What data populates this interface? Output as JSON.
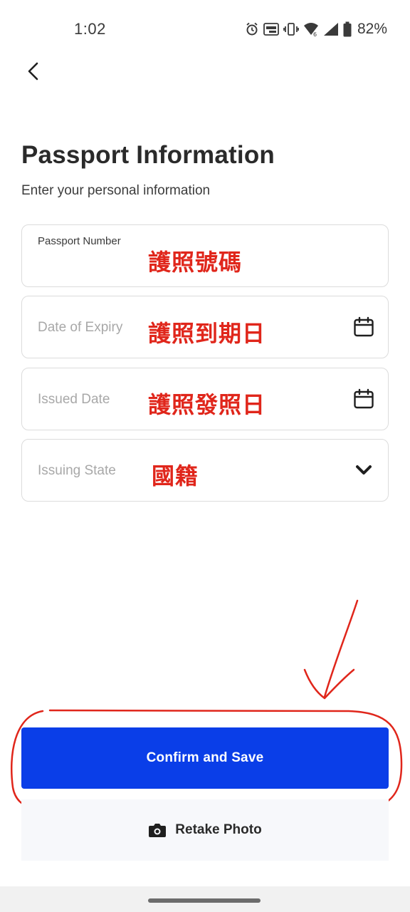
{
  "status_bar": {
    "time": "1:02",
    "battery": "82%",
    "icons": [
      "alarm-icon",
      "auto-brightness-icon",
      "vibrate-icon",
      "wifi-icon",
      "signal-icon",
      "battery-icon"
    ]
  },
  "header": {
    "back_icon": "chevron-left-icon",
    "title": "Passport Information",
    "subtitle": "Enter your personal information"
  },
  "form": {
    "passport_number": {
      "label": "Passport Number",
      "annotation": "護照號碼"
    },
    "date_of_expiry": {
      "placeholder": "Date of Expiry",
      "annotation": "護照到期日",
      "icon": "calendar-icon"
    },
    "issued_date": {
      "placeholder": "Issued Date",
      "annotation": "護照發照日",
      "icon": "calendar-icon"
    },
    "issuing_state": {
      "placeholder": "Issuing State",
      "annotation": "國籍",
      "icon": "chevron-down-icon"
    }
  },
  "actions": {
    "confirm_label": "Confirm and Save",
    "retake_label": "Retake Photo",
    "retake_icon": "camera-icon"
  },
  "colors": {
    "primary": "#0a3ee8",
    "annotation": "#e0261b",
    "field_border": "#dcdcdc",
    "placeholder": "#a8a8a8"
  }
}
